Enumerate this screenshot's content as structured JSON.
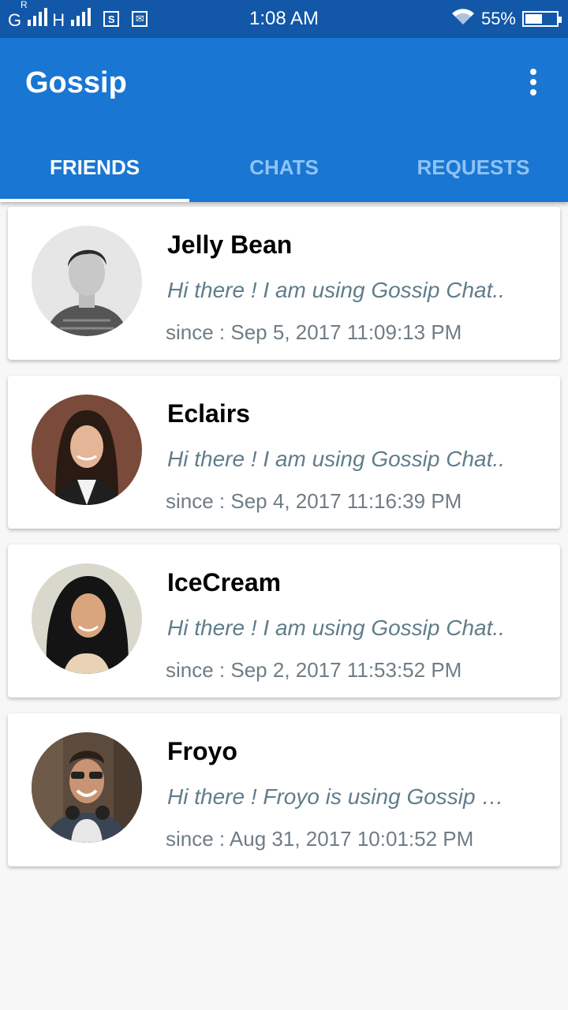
{
  "status_bar": {
    "carrier1": "G",
    "carrier1_roaming": "R",
    "carrier2": "H",
    "notif_icon_1": "S",
    "notif_icon_2": "✉",
    "time": "1:08 AM",
    "wifi_icon": "wifi-icon",
    "battery_text": "55%",
    "battery_level": 0.55
  },
  "app_bar": {
    "title": "Gossip",
    "menu_icon": "overflow-menu-icon",
    "color": "#1976d2"
  },
  "tabs": [
    {
      "label": "FRIENDS",
      "active": true
    },
    {
      "label": "CHATS",
      "active": false
    },
    {
      "label": "REQUESTS",
      "active": false
    }
  ],
  "friends": [
    {
      "name": "Jelly Bean",
      "status": "Hi there ! I am using Gossip Chat..",
      "since": "since : Sep 5, 2017 11:09:13 PM"
    },
    {
      "name": "Eclairs",
      "status": "Hi there ! I am using Gossip Chat..",
      "since": "since : Sep 4, 2017 11:16:39 PM"
    },
    {
      "name": "IceCream",
      "status": "Hi there ! I am using Gossip Chat..",
      "since": "since : Sep 2, 2017 11:53:52 PM"
    },
    {
      "name": "Froyo",
      "status": "Hi there ! Froyo is using Gossip Chat..",
      "since": "since : Aug 31, 2017 10:01:52 PM"
    }
  ]
}
